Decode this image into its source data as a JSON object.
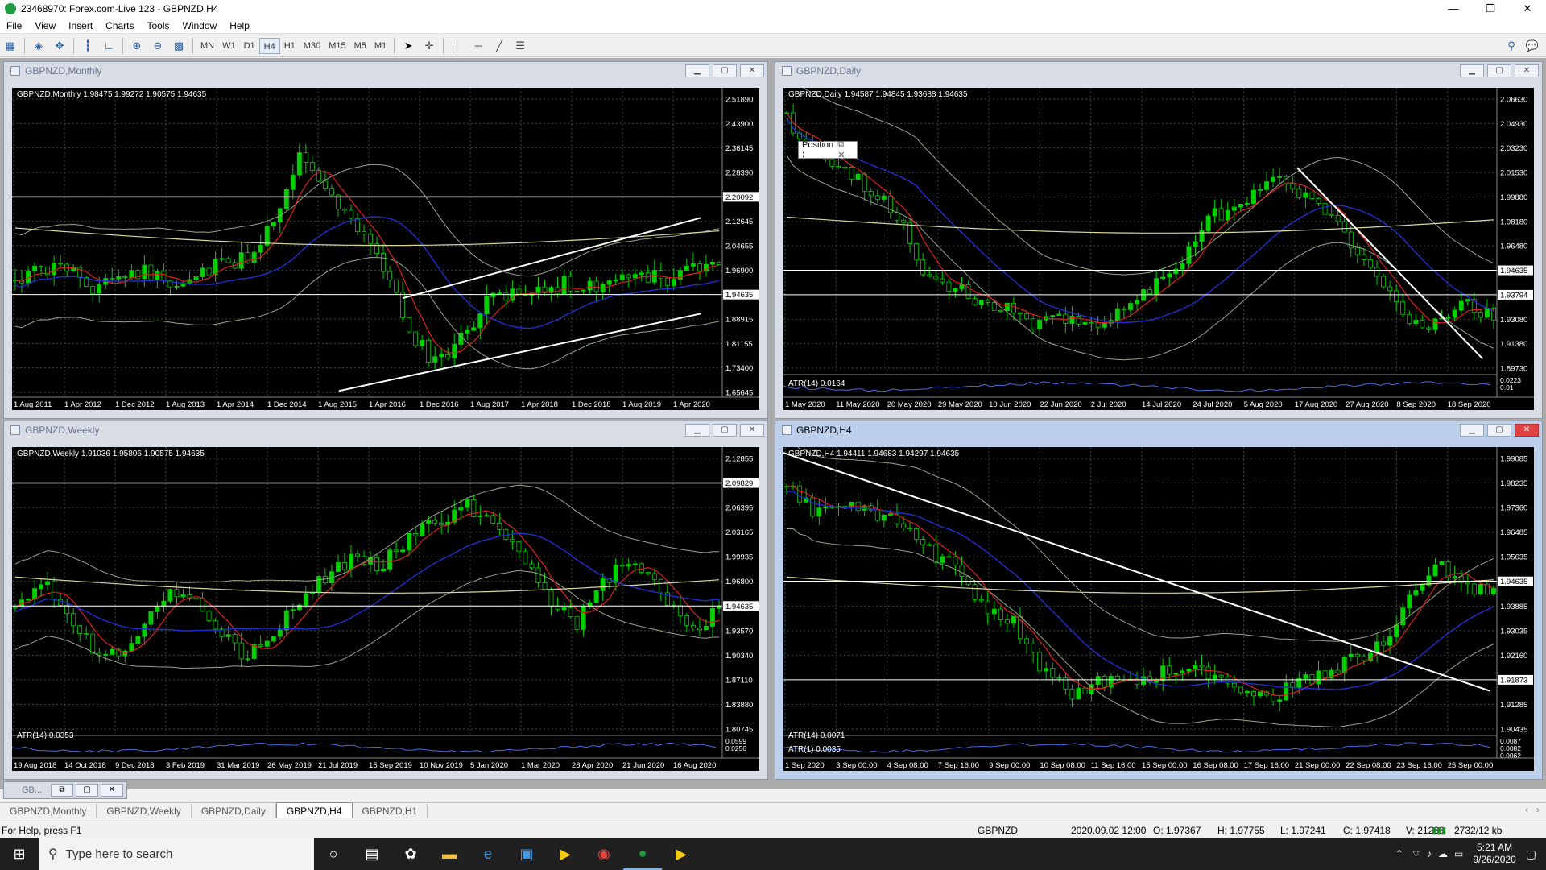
{
  "app": {
    "title": "23468970: Forex.com-Live 123 - GBPNZD,H4",
    "win_minimize": "—",
    "win_maximize": "❐",
    "win_close": "✕"
  },
  "menu": [
    "File",
    "View",
    "Insert",
    "Charts",
    "Tools",
    "Window",
    "Help"
  ],
  "toolbar": {
    "timeframes": [
      "MN",
      "W1",
      "D1",
      "H4",
      "H1",
      "M30",
      "M15",
      "M5",
      "M1"
    ],
    "active_timeframe": "H4"
  },
  "charts": [
    {
      "id": "monthly",
      "window_title": "GBPNZD,Monthly",
      "ohlc": "GBPNZD,Monthly  1.98475 1.99272 1.90575 1.94635",
      "price_labels": [
        "2.51890",
        "2.43900",
        "2.36145",
        "2.28390",
        "2.20092",
        "2.12645",
        "2.04655",
        "1.96900",
        "1.94635",
        "1.88915",
        "1.81155",
        "1.73400",
        "1.65645"
      ],
      "highlight_prices": [
        "2.20092",
        "1.94635"
      ],
      "time_labels": [
        "1 Aug 2011",
        "1 Apr 2012",
        "1 Dec 2012",
        "1 Aug 2013",
        "1 Apr 2014",
        "1 Dec 2014",
        "1 Aug 2015",
        "1 Apr 2016",
        "1 Dec 2016",
        "1 Aug 2017",
        "1 Apr 2018",
        "1 Dec 2018",
        "1 Aug 2019",
        "1 Apr 2020"
      ]
    },
    {
      "id": "daily",
      "window_title": "GBPNZD,Daily",
      "ohlc": "GBPNZD,Daily  1.94587 1.94845 1.93688 1.94635",
      "price_labels": [
        "2.06630",
        "2.04930",
        "2.03230",
        "2.01530",
        "1.99880",
        "1.98180",
        "1.96480",
        "1.94635",
        "1.93794",
        "1.93080",
        "1.91380",
        "1.89730"
      ],
      "highlight_prices": [
        "1.94635",
        "1.93794"
      ],
      "indicator_label": "ATR(14) 0.0164",
      "indicator_values": [
        "0.0223",
        "0.01"
      ],
      "time_labels": [
        "1 May 2020",
        "11 May 2020",
        "20 May 2020",
        "29 May 2020",
        "10 Jun 2020",
        "22 Jun 2020",
        "2 Jul 2020",
        "14 Jul 2020",
        "24 Jul 2020",
        "5 Aug 2020",
        "17 Aug 2020",
        "27 Aug 2020",
        "8 Sep 2020",
        "18 Sep 2020"
      ],
      "popup_label": "Position :"
    },
    {
      "id": "weekly",
      "window_title": "GBPNZD,Weekly",
      "ohlc": "GBPNZD,Weekly  1.91036 1.95806 1.90575 1.94635",
      "price_labels": [
        "2.12855",
        "2.09829",
        "2.06395",
        "2.03165",
        "1.99935",
        "1.96800",
        "1.94635",
        "1.93570",
        "1.90340",
        "1.87110",
        "1.83880",
        "1.80745"
      ],
      "highlight_prices": [
        "2.09829",
        "1.94635"
      ],
      "indicator_label": "ATR(14) 0.0353",
      "indicator_values": [
        "0.0599",
        "0.0256"
      ],
      "time_labels": [
        "19 Aug 2018",
        "14 Oct 2018",
        "9 Dec 2018",
        "3 Feb 2019",
        "31 Mar 2019",
        "26 May 2019",
        "21 Jul 2019",
        "15 Sep 2019",
        "10 Nov 2019",
        "5 Jan 2020",
        "1 Mar 2020",
        "26 Apr 2020",
        "21 Jun 2020",
        "16 Aug 2020"
      ]
    },
    {
      "id": "h4",
      "window_title": "GBPNZD,H4",
      "ohlc": "GBPNZD,H4  1.94411 1.94683 1.94297 1.94635",
      "price_labels": [
        "1.99085",
        "1.98235",
        "1.97360",
        "1.96485",
        "1.95635",
        "1.94635",
        "1.93885",
        "1.93035",
        "1.92160",
        "1.91873",
        "1.91285",
        "1.90435"
      ],
      "highlight_prices": [
        "1.94635",
        "1.91873"
      ],
      "indicator_label": "ATR(14) 0.0071",
      "indicator_label2": "ATR(1) 0.0035",
      "indicator_values": [
        "0.0087",
        "0.0082",
        "0.0062"
      ],
      "time_labels": [
        "1 Sep 2020",
        "3 Sep 00:00",
        "4 Sep 08:00",
        "7 Sep 16:00",
        "9 Sep 00:00",
        "10 Sep 08:00",
        "11 Sep 16:00",
        "15 Sep 00:00",
        "16 Sep 08:00",
        "17 Sep 16:00",
        "21 Sep 00:00",
        "22 Sep 08:00",
        "23 Sep 16:00",
        "25 Sep 00:00"
      ]
    }
  ],
  "minimized_window": "GB...",
  "tabs": [
    "GBPNZD,Monthly",
    "GBPNZD,Weekly",
    "GBPNZD,Daily",
    "GBPNZD,H4",
    "GBPNZD,H1"
  ],
  "active_tab": "GBPNZD,H4",
  "status": {
    "help": "For Help, press F1",
    "symbol": "GBPNZD",
    "datetime": "2020.09.02 12:00",
    "open": "O: 1.97367",
    "high": "H: 1.97755",
    "low": "L: 1.97241",
    "close": "C: 1.97418",
    "volume": "V: 21266",
    "traffic": "2732/12 kb"
  },
  "taskbar": {
    "search_placeholder": "Type here to search",
    "time": "5:21 AM",
    "date": "9/26/2020"
  },
  "colors": {
    "chart_bg": "#000000",
    "bull_candle": "#00d000",
    "bear_candle": "#000000",
    "grid": "#3a4a3a",
    "ma_red": "#e02020",
    "ma_blue": "#1f2fd0",
    "bands": "#9aa58a",
    "slow_ma": "#d8d8a0"
  }
}
